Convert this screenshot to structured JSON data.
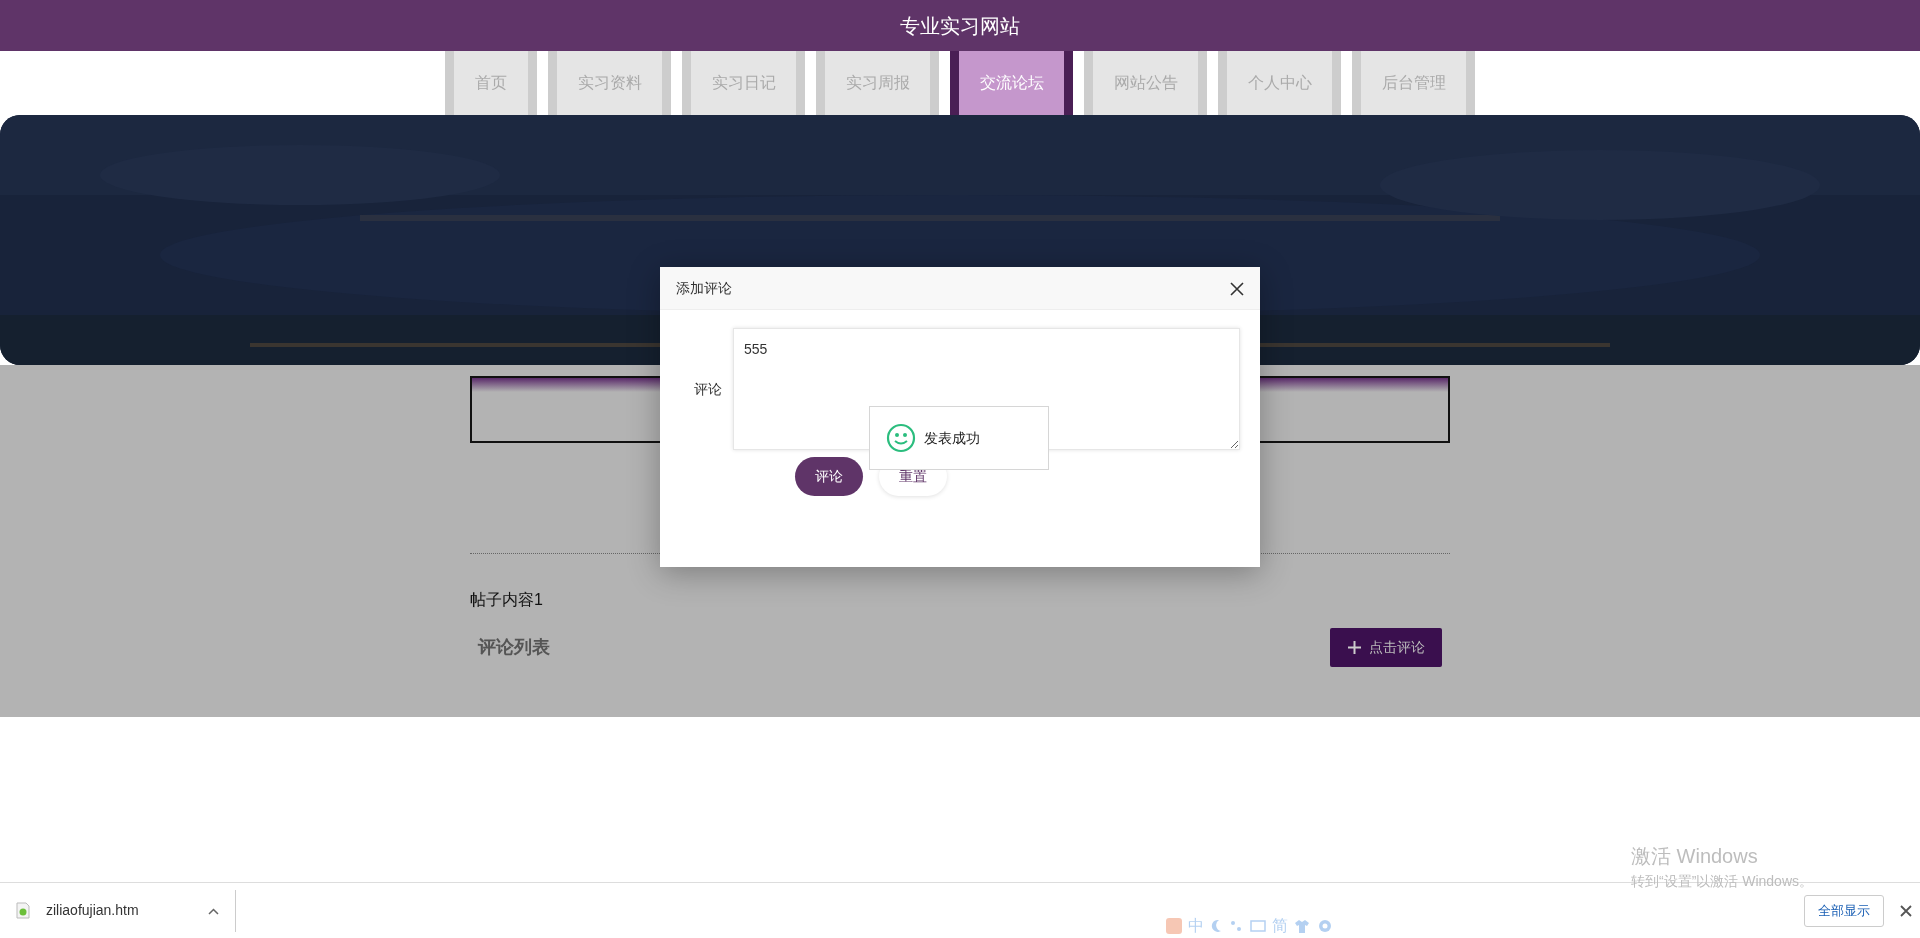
{
  "site": {
    "title": "专业实习网站"
  },
  "nav": [
    {
      "label": "首页",
      "selected": false
    },
    {
      "label": "实习资料",
      "selected": false
    },
    {
      "label": "实习日记",
      "selected": false
    },
    {
      "label": "实习周报",
      "selected": false
    },
    {
      "label": "交流论坛",
      "selected": true
    },
    {
      "label": "网站公告",
      "selected": false
    },
    {
      "label": "个人中心",
      "selected": false
    },
    {
      "label": "后台管理",
      "selected": false
    }
  ],
  "post": {
    "content": "帖子内容1",
    "comments_heading": "评论列表",
    "comment_button": "点击评论"
  },
  "dialog": {
    "title": "添加评论",
    "field_label": "评论",
    "comment_value": "555",
    "buttons": [
      {
        "label": "评论",
        "kind": "primary"
      },
      {
        "label": "重置",
        "kind": "secondary"
      }
    ]
  },
  "toast": {
    "message": "发表成功"
  },
  "download_bar": {
    "file": "ziliaofujian.htm",
    "show_all": "全部显示"
  },
  "ime_toolbar": {
    "mode": "中",
    "script": "简"
  },
  "windows_notice": {
    "title": "激活 Windows",
    "subtitle": "转到“设置”以激活 Windows。"
  }
}
